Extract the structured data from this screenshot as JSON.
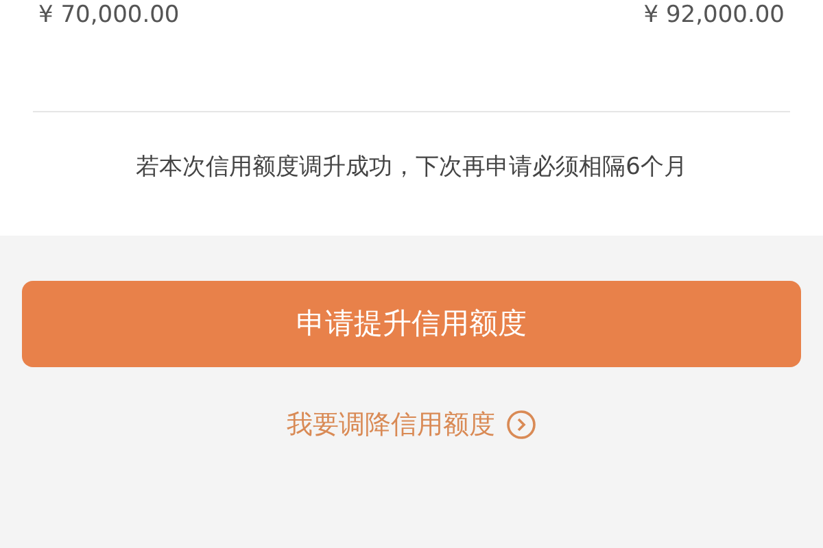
{
  "amounts": [
    {
      "text": "¥ 70,000.00"
    },
    {
      "text": "¥ 92,000.00"
    }
  ],
  "notice": "若本次信用额度调升成功，下次再申请必须相隔6个月",
  "primary_button": "申请提升信用额度",
  "link": "我要调降信用额度"
}
